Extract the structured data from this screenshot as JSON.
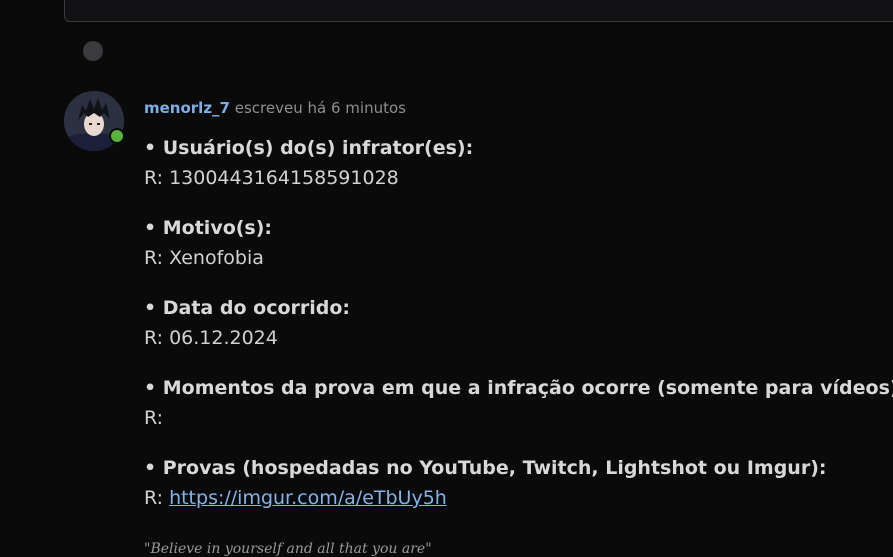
{
  "post": {
    "author": "menorlz_7",
    "meta": " escreveu há 6 minutos",
    "avatar_icon": "anime-avatar",
    "online_color": "#57b33b"
  },
  "fields": [
    {
      "label": "• Usuário(s) do(s) infrator(es):",
      "prefix": "R: ",
      "value": "1300443164158591028"
    },
    {
      "label": "• Motivo(s):",
      "prefix": "R: ",
      "value": "Xenofobia"
    },
    {
      "label": "• Data do ocorrido:",
      "prefix": "R: ",
      "value": "06.12.2024"
    },
    {
      "label": "• Momentos da prova em que a infração ocorre (somente para vídeos):",
      "prefix": "R:",
      "value": ""
    },
    {
      "label": "• Provas (hospedadas no YouTube, Twitch, Lightshot ou Imgur):",
      "prefix": "R: ",
      "link": "https://imgur.com/a/eTbUy5h"
    }
  ],
  "signature": "\"Believe in yourself and all that you are\"",
  "colors": {
    "accent": "#7eaee6",
    "link": "#82b4ea",
    "background": "#0a0a0b"
  }
}
